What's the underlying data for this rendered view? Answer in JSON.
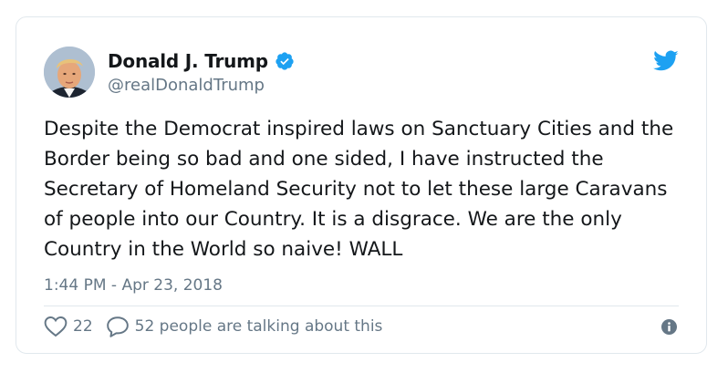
{
  "tweet": {
    "author": {
      "display_name": "Donald J. Trump",
      "handle": "@realDonaldTrump",
      "verified": true
    },
    "text": "Despite the Democrat inspired laws on Sanctuary Cities and the\nBorder being so bad and one sided, I have instructed the\nSecretary of Homeland Security not to let these large Caravans\nof people into our Country. It is a disgrace. We are the only\nCountry in the World so naive! WALL",
    "timestamp": "1:44 PM - Apr 23, 2018",
    "likes": "22",
    "conversation": "52 people are talking about this"
  },
  "icons": {
    "avatar": "profile-photo",
    "verified": "verified-badge-icon",
    "brand": "twitter-bird-icon",
    "like": "heart-icon",
    "reply": "speech-bubble-icon",
    "info": "info-icon"
  },
  "colors": {
    "brand": "#1da1f2",
    "text": "#14171a",
    "secondary": "#657786",
    "border": "#e1e8ed"
  }
}
